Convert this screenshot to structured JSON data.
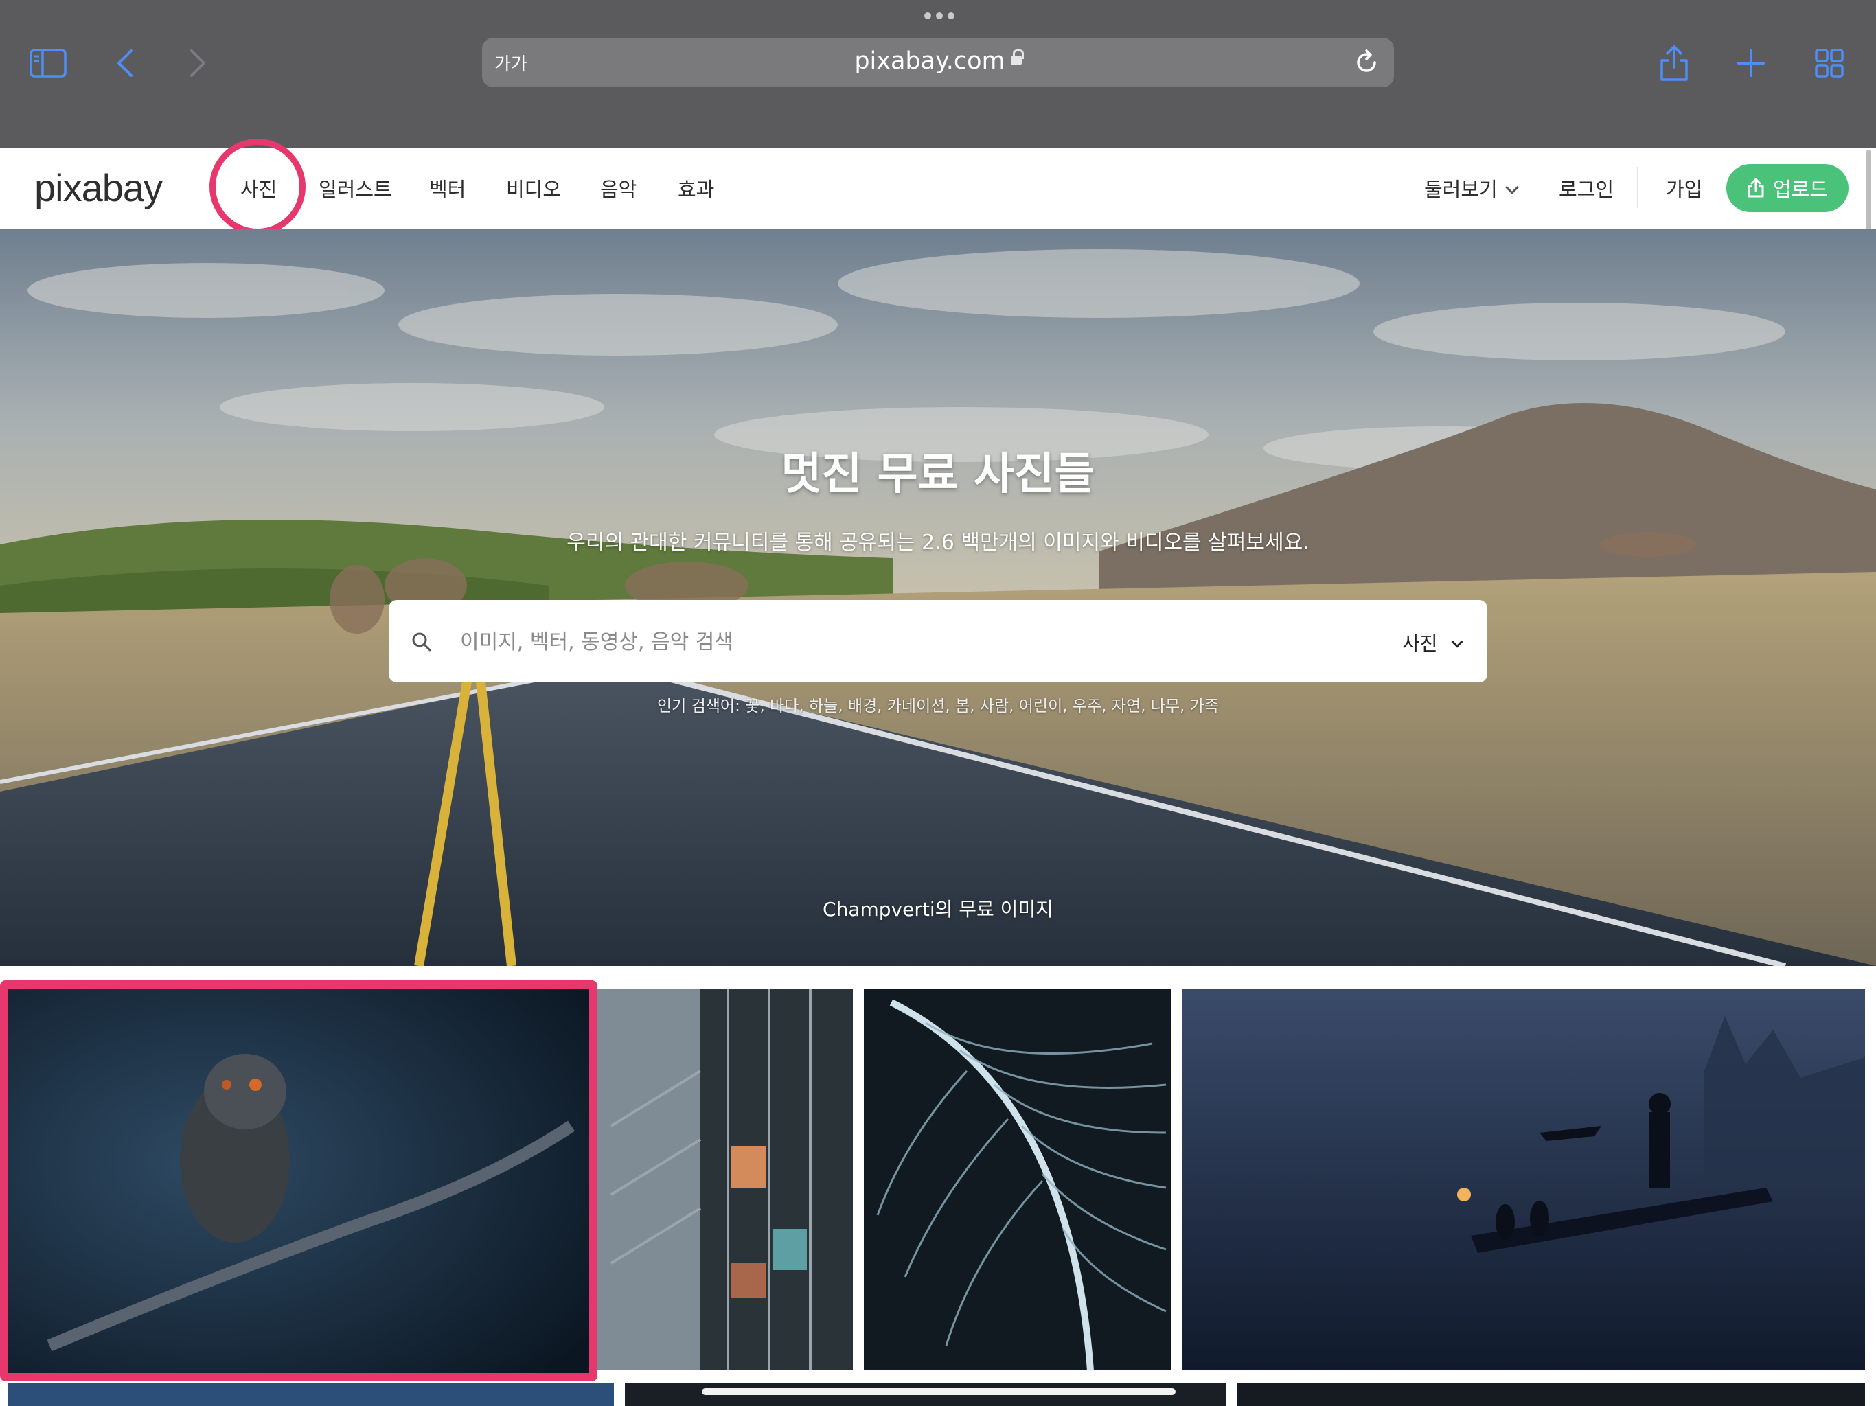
{
  "browser": {
    "text_size_label": "가가",
    "url": "pixabay.com",
    "icons": [
      "sidebar-icon",
      "back-icon",
      "forward-icon",
      "reload-icon",
      "share-icon",
      "new-tab-icon",
      "tabs-overview-icon"
    ]
  },
  "header": {
    "logo": "pixabay",
    "nav": [
      "사진",
      "일러스트",
      "벡터",
      "비디오",
      "음악",
      "효과"
    ],
    "explore": "둘러보기",
    "login": "로그인",
    "signup": "가입",
    "upload": "업로드"
  },
  "hero": {
    "title": "멋진 무료 사진들",
    "subtitle": "우리의 관대한 커뮤니티를 통해 공유되는 2.6 백만개의 이미지와 비디오를 살펴보세요.",
    "search": {
      "placeholder": "이미지, 벡터, 동영상, 음악 검색",
      "type": "사진"
    },
    "popular": "인기 검색어: 꽃, 바다, 하늘, 배경, 카네이션, 봄, 사람, 어린이, 우주, 자연, 나무, 가족",
    "credit": "Champverti의 무료 이미지"
  },
  "colors": {
    "accent_pink": "#e6386c",
    "upload_green": "#4bc27a",
    "chrome_gray": "#5b5b5d",
    "link_blue": "#4f8ef7"
  }
}
